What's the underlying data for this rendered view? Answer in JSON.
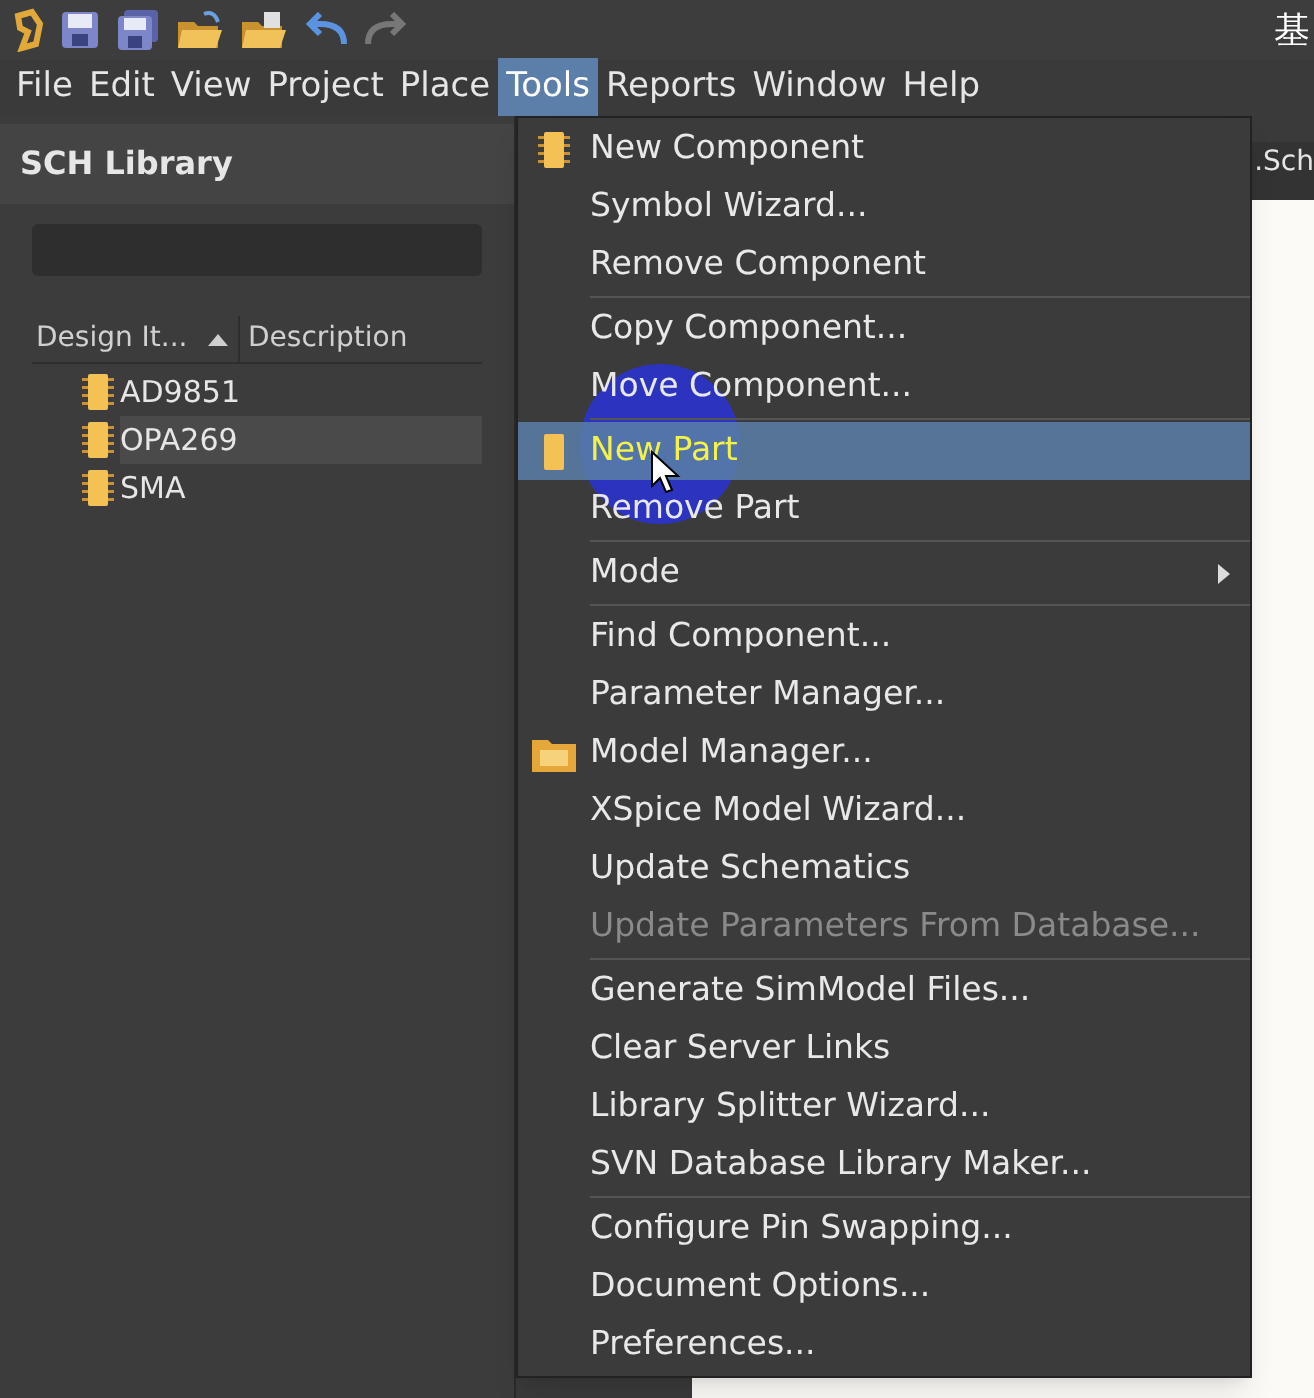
{
  "window": {
    "title": "基"
  },
  "menu_bar": [
    {
      "label": "File",
      "selected": false
    },
    {
      "label": "Edit",
      "selected": false
    },
    {
      "label": "View",
      "selected": false
    },
    {
      "label": "Project",
      "selected": false
    },
    {
      "label": "Place",
      "selected": false
    },
    {
      "label": "Tools",
      "selected": true
    },
    {
      "label": "Reports",
      "selected": false
    },
    {
      "label": "Window",
      "selected": false
    },
    {
      "label": "Help",
      "selected": false
    }
  ],
  "panel": {
    "title": "SCH Library",
    "columns": [
      "Design It...",
      "Description"
    ],
    "rows": [
      {
        "name": "AD9851",
        "selected": false
      },
      {
        "name": "OPA269",
        "selected": true
      },
      {
        "name": "SMA",
        "selected": false
      }
    ]
  },
  "document_tab": {
    "label": ".Sch"
  },
  "tools_menu": [
    [
      {
        "label": "New Component",
        "kind": "component",
        "selected": false,
        "disabled": false
      },
      {
        "label": "Symbol Wizard...",
        "kind": "plain",
        "selected": false,
        "disabled": false
      },
      {
        "label": "Remove Component",
        "kind": "plain",
        "selected": false,
        "disabled": false
      }
    ],
    [
      {
        "label": "Copy Component...",
        "kind": "plain",
        "selected": false,
        "disabled": false
      },
      {
        "label": "Move Component...",
        "kind": "plain",
        "selected": false,
        "disabled": false
      }
    ],
    [
      {
        "label": "New Part",
        "kind": "part",
        "selected": true,
        "disabled": false
      },
      {
        "label": "Remove Part",
        "kind": "plain",
        "selected": false,
        "disabled": false
      }
    ],
    [
      {
        "label": "Mode",
        "kind": "submenu",
        "selected": false,
        "disabled": false
      }
    ],
    [
      {
        "label": "Find Component...",
        "kind": "plain",
        "selected": false,
        "disabled": false
      },
      {
        "label": "Parameter Manager...",
        "kind": "plain",
        "selected": false,
        "disabled": false
      },
      {
        "label": "Model Manager...",
        "kind": "model",
        "selected": false,
        "disabled": false
      },
      {
        "label": "XSpice Model Wizard...",
        "kind": "plain",
        "selected": false,
        "disabled": false
      },
      {
        "label": "Update Schematics",
        "kind": "plain",
        "selected": false,
        "disabled": false
      },
      {
        "label": "Update Parameters From Database...",
        "kind": "plain",
        "selected": false,
        "disabled": true
      }
    ],
    [
      {
        "label": "Generate SimModel Files...",
        "kind": "plain",
        "selected": false,
        "disabled": false
      },
      {
        "label": "Clear Server Links",
        "kind": "plain",
        "selected": false,
        "disabled": false
      },
      {
        "label": "Library Splitter Wizard...",
        "kind": "plain",
        "selected": false,
        "disabled": false
      },
      {
        "label": "SVN Database Library Maker...",
        "kind": "plain",
        "selected": false,
        "disabled": false
      }
    ],
    [
      {
        "label": "Configure Pin Swapping...",
        "kind": "plain",
        "selected": false,
        "disabled": false
      },
      {
        "label": "Document Options...",
        "kind": "plain",
        "selected": false,
        "disabled": false
      },
      {
        "label": "Preferences...",
        "kind": "plain",
        "selected": false,
        "disabled": false
      }
    ]
  ]
}
